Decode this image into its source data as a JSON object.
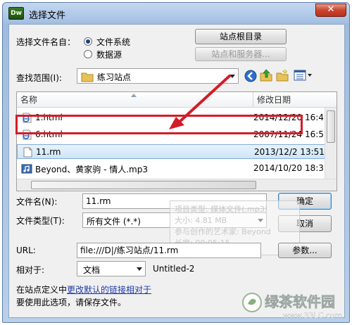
{
  "window": {
    "title": "选择文件",
    "app_badge": "Dw",
    "close_glyph": "✕"
  },
  "select_from": {
    "label": "选择文件名自：",
    "options": [
      {
        "label": "文件系统",
        "checked": true
      },
      {
        "label": "数据源",
        "checked": false
      }
    ],
    "site_root_button": "站点根目录",
    "site_server_button": "站点和服务器..."
  },
  "look_in": {
    "label": "查找范围(I):",
    "value": "练习站点"
  },
  "columns": {
    "name": "名称",
    "date": "修改日期"
  },
  "files": [
    {
      "name": "1.html",
      "date": "2014/12/20 16:4",
      "icon": "ie-html-icon"
    },
    {
      "name": "6.html",
      "date": "2007/11/24 16:5",
      "icon": "ie-html-icon"
    },
    {
      "name": "11.rm",
      "date": "2013/12/2 13:51",
      "icon": "blank-file-icon",
      "selected": true
    },
    {
      "name": "Beyond、黄家驹 - 情人.mp3",
      "date": "2014/10/20 18:3",
      "icon": "mp3-icon"
    }
  ],
  "file_name": {
    "label": "文件名(N):",
    "value": "11.rm"
  },
  "file_type": {
    "label": "文件类型(T):",
    "value": "所有文件 (*.*)"
  },
  "buttons": {
    "ok": "确定",
    "cancel": "取消",
    "params": "参数..."
  },
  "tooltip": {
    "lines": [
      "项目类型: 媒体文件(.mp3)",
      "大小: 4.81 MB",
      "参与创作的艺术家: Beyond",
      "长度: 00:05:15"
    ]
  },
  "url": {
    "label": "URL:",
    "value": "file:///D|/练习站点/11.rm"
  },
  "relative": {
    "label": "相对于:",
    "value": "文档",
    "doc_name": "Untitled-2"
  },
  "note": {
    "prefix": "在站点定义中",
    "link": "更改默认的链接相对于",
    "line2": "要使用此选项，请保存文件。"
  },
  "watermark": {
    "brand": "绿茶软件园",
    "url": "www.33LC.com"
  },
  "colors": {
    "highlight": "#d31d28",
    "link": "#1f3aa8",
    "selection": "#cde5f8"
  }
}
